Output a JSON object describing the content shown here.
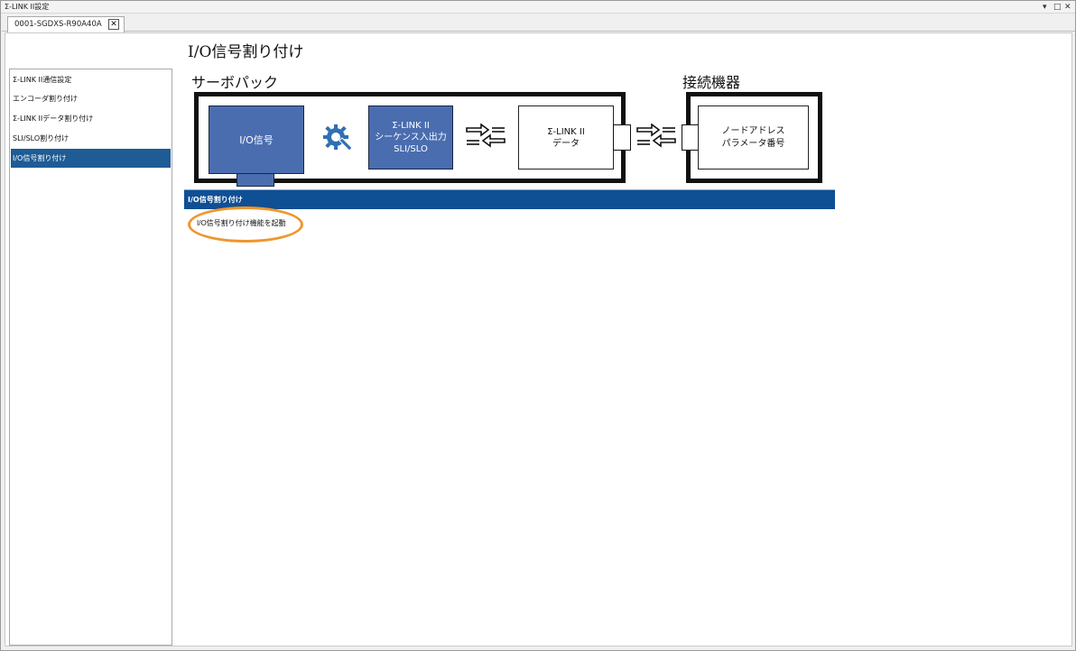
{
  "window": {
    "title": "Σ-LINK II設定",
    "controls": {
      "menu": "▾",
      "restore": "□",
      "close": "✕"
    }
  },
  "tabs": [
    {
      "label": "0001-SGDXS-R90A40A",
      "close": "✕"
    }
  ],
  "page_title": "I/O信号割り付け",
  "sidebar": {
    "items": [
      {
        "label": "Σ-LINK II通信設定"
      },
      {
        "label": "エンコーダ割り付け"
      },
      {
        "label": "Σ-LINK IIデータ割り付け"
      },
      {
        "label": "SLI/SLO割り付け"
      },
      {
        "label": "I/O信号割り付け"
      }
    ],
    "active_index": 4
  },
  "diagram": {
    "servo_label": "サーボパック",
    "device_label": "接続機器",
    "io_box": "I/O信号",
    "sequence_box": {
      "line1": "Σ-LINK II",
      "line2": "シーケンス入出力",
      "line3": "SLI/SLO"
    },
    "data_box": {
      "line1": "Σ-LINK II",
      "line2": "データ"
    },
    "node_box": {
      "line1": "ノードアドレス",
      "line2": "パラメータ番号"
    },
    "icons": [
      "gear-wrench-icon",
      "bidirectional-arrows-icon"
    ],
    "colors": {
      "blue_box": "#4a6db0",
      "section_bar": "#0f4f94",
      "highlight_ring": "#f0962c"
    }
  },
  "section": {
    "title": "I/O信号割り付け",
    "launch_button": "I/O信号割り付け機能を起動"
  }
}
